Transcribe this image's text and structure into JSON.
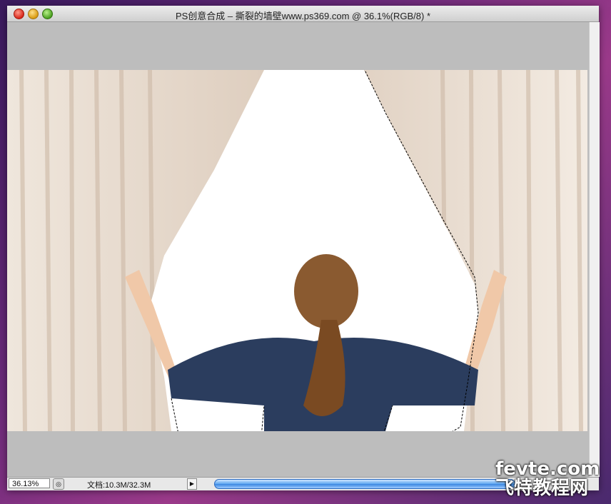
{
  "window": {
    "title": "PS创意合成 – 撕裂的墙壁www.ps369.com @ 36.1%(RGB/8) *"
  },
  "status": {
    "zoom": "36.13%",
    "doc_info": "文档:10.3M/32.3M",
    "arrow": "▶"
  },
  "watermark": {
    "line1": "fevte.com",
    "line2": "飞特教程网"
  },
  "icons": {
    "zoom_icon": "◎"
  }
}
